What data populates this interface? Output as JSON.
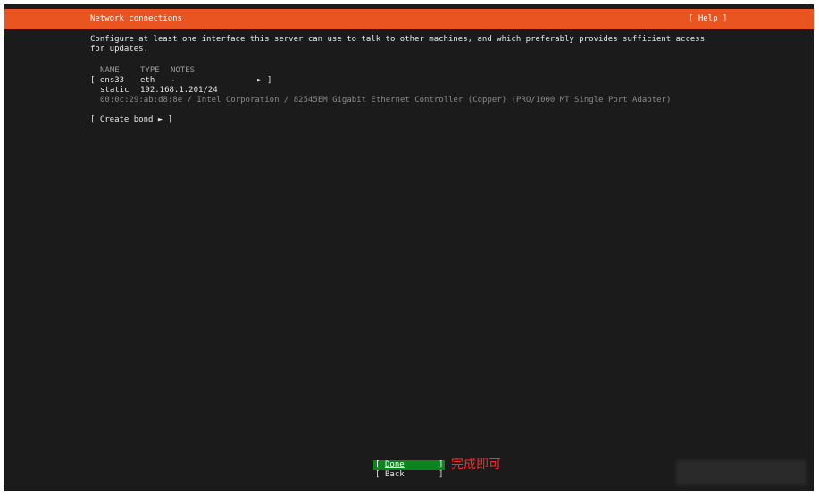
{
  "header": {
    "title": "Network connections",
    "help_label": "[ Help ]"
  },
  "description": "Configure at least one interface this server can use to talk to other machines, and which preferably provides sufficient access for updates.",
  "table": {
    "columns": [
      "NAME",
      "TYPE",
      "NOTES"
    ],
    "interfaces": [
      {
        "name": "ens33",
        "type": "eth",
        "notes": "-",
        "arrow": "►",
        "addressing": "static",
        "address": "192.168.1.201/24",
        "mac_and_vendor": "00:0c:29:ab:d8:8e / Intel Corporation / 82545EM Gigabit Ethernet Controller (Copper) (PRO/1000 MT Single Port Adapter)"
      }
    ]
  },
  "create_bond_label": "[ Create bond ► ]",
  "footer": {
    "done_label": "Done",
    "back_label": "Back"
  },
  "annotation": "完成即可",
  "colors": {
    "titlebar": "#e95420",
    "background": "#1b1b1b",
    "done_button": "#0e8420",
    "annotation": "#ff2a2a"
  }
}
